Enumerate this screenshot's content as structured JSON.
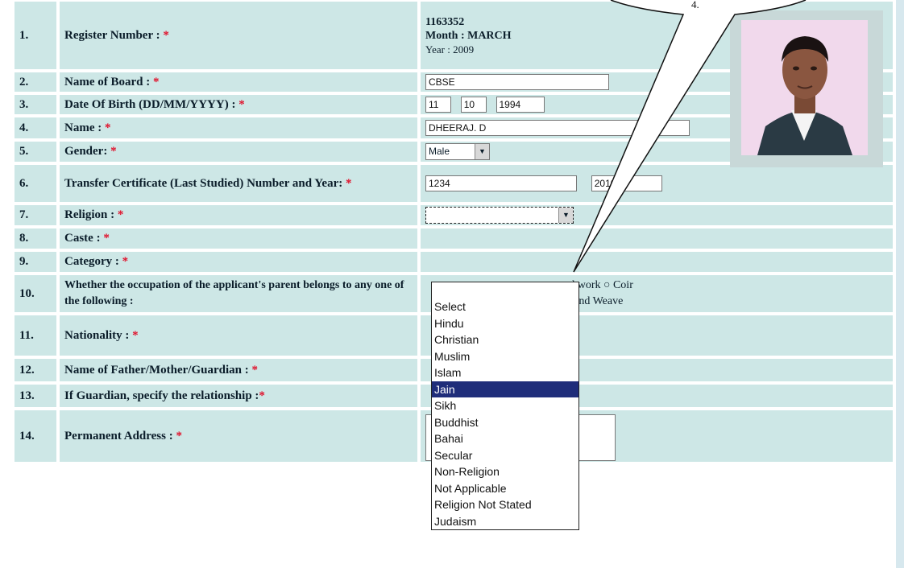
{
  "rows": [
    {
      "num": "1.",
      "label": "Register Number :",
      "reg_number": "1163352",
      "month": "Month : MARCH",
      "year": "Year :    2009"
    },
    {
      "num": "2.",
      "label": "Name of Board :",
      "value": "CBSE"
    },
    {
      "num": "3.",
      "label": "Date Of Birth (DD/MM/YYYY) :",
      "day": "11",
      "month": "10",
      "year": "1994"
    },
    {
      "num": "4.",
      "label": "Name :",
      "value": "DHEERAJ. D"
    },
    {
      "num": "5.",
      "label": "Gender:",
      "value": "Male"
    },
    {
      "num": "6.",
      "label": "Transfer Certificate (Last Studied) Number and Year:",
      "tc_number": "1234",
      "tc_year": "2010"
    },
    {
      "num": "7.",
      "label": "Religion :",
      "value": ""
    },
    {
      "num": "8.",
      "label": "Caste :"
    },
    {
      "num": "9.",
      "label": "Category :"
    },
    {
      "num": "10.",
      "label": "Whether the occupation of the applicant's parent belongs to any one of the following :",
      "opt_text_1": "ed work",
      "opt_coir": "Coir",
      "opt_hand_weave": "Hand Weave"
    },
    {
      "num": "11.",
      "label": "Nationality :"
    },
    {
      "num": "12.",
      "label": "Name of Father/Mother/Guardian :"
    },
    {
      "num": "13.",
      "label": "If Guardian, specify the relationship :"
    },
    {
      "num": "14.",
      "label": "Permanent Address :"
    }
  ],
  "required_mark": "*",
  "religion_dropdown": {
    "options": [
      "Select",
      "Hindu",
      "Christian",
      "Muslim",
      "Islam",
      "Jain",
      "Sikh",
      "Buddhist",
      "Bahai",
      "Secular",
      "Non-Religion",
      "Not Applicable",
      "Religion Not Stated",
      "Judaism"
    ],
    "highlighted": "Jain"
  },
  "callout_text": "4."
}
